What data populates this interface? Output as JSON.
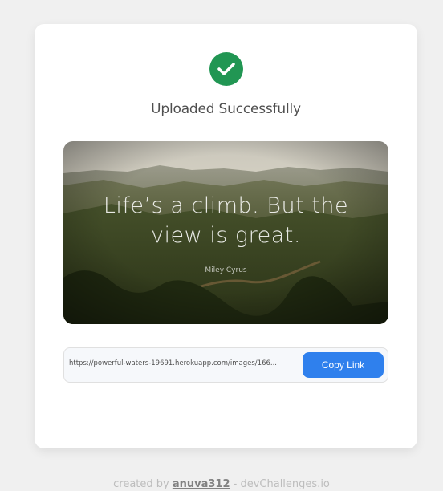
{
  "status": {
    "title": "Uploaded Successfully",
    "icon": "check-circle-icon",
    "icon_color": "#219653"
  },
  "image": {
    "quote_line1": "Life’s a climb. But the",
    "quote_line2": "view is great.",
    "author": "Miley Cyrus"
  },
  "link": {
    "url": "https://powerful-waters-19691.herokuapp.com/images/166...",
    "copy_label": "Copy Link",
    "button_color": "#2f80ed"
  },
  "footer": {
    "prefix": "created by ",
    "author": "anuva312",
    "suffix": " - devChallenges.io"
  }
}
